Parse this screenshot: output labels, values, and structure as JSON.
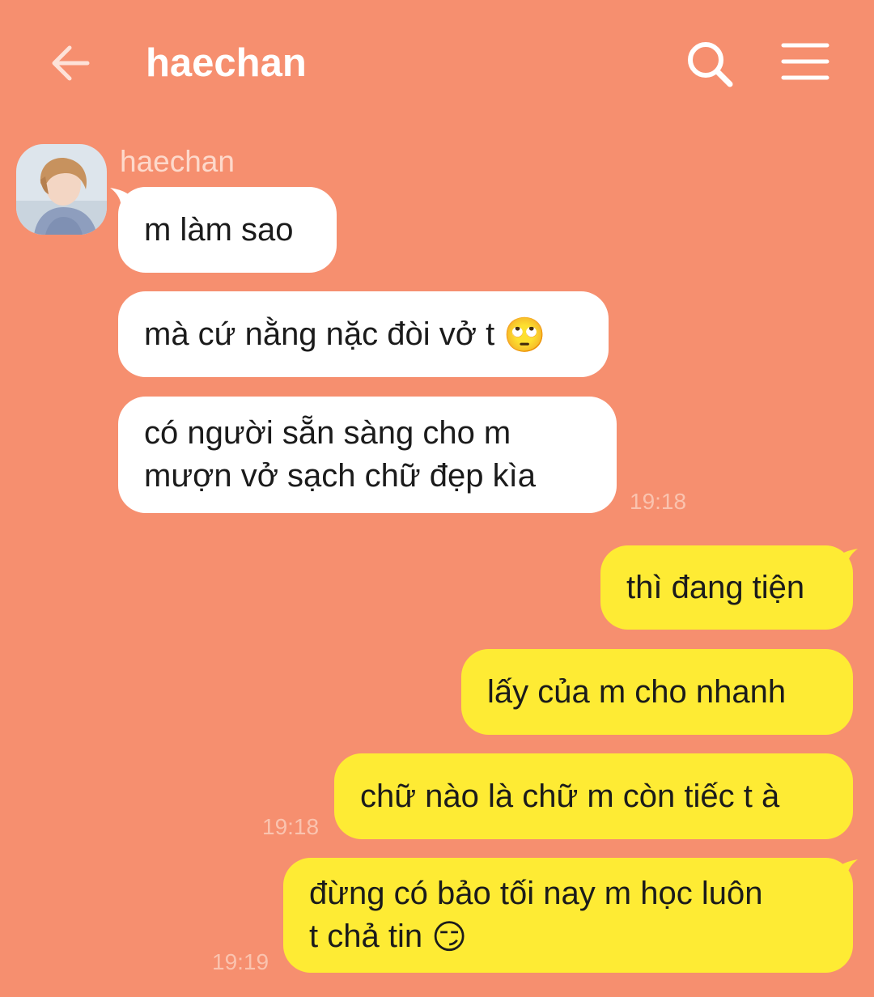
{
  "header": {
    "title": "haechan",
    "back_icon": "arrow-left-icon",
    "search_icon": "search-icon",
    "menu_icon": "hamburger-menu-icon"
  },
  "colors": {
    "background": "#F68F6F",
    "incoming_bubble": "#FFFFFF",
    "outgoing_bubble": "#FEEB34",
    "timestamp": "#FAC3AF"
  },
  "conversation": {
    "sender_name": "haechan",
    "incoming": [
      {
        "lines": [
          "m làm sao"
        ]
      },
      {
        "lines": [
          "mà cứ nằng nặc đòi vở t"
        ],
        "emoji": "🙄"
      },
      {
        "lines": [
          "có người sẵn sàng cho m",
          "mượn vở sạch chữ đẹp kìa"
        ]
      }
    ],
    "incoming_time": "19:18",
    "outgoing": [
      {
        "lines": [
          "thì đang tiện"
        ]
      },
      {
        "lines": [
          "lấy của m cho nhanh"
        ]
      },
      {
        "lines": [
          "chữ nào là chữ m còn tiếc t à"
        ],
        "time": "19:18"
      },
      {
        "lines": [
          "đừng có bảo tối nay m học luôn",
          "t chả tin"
        ],
        "emoji": "😏",
        "time": "19:19"
      }
    ]
  }
}
